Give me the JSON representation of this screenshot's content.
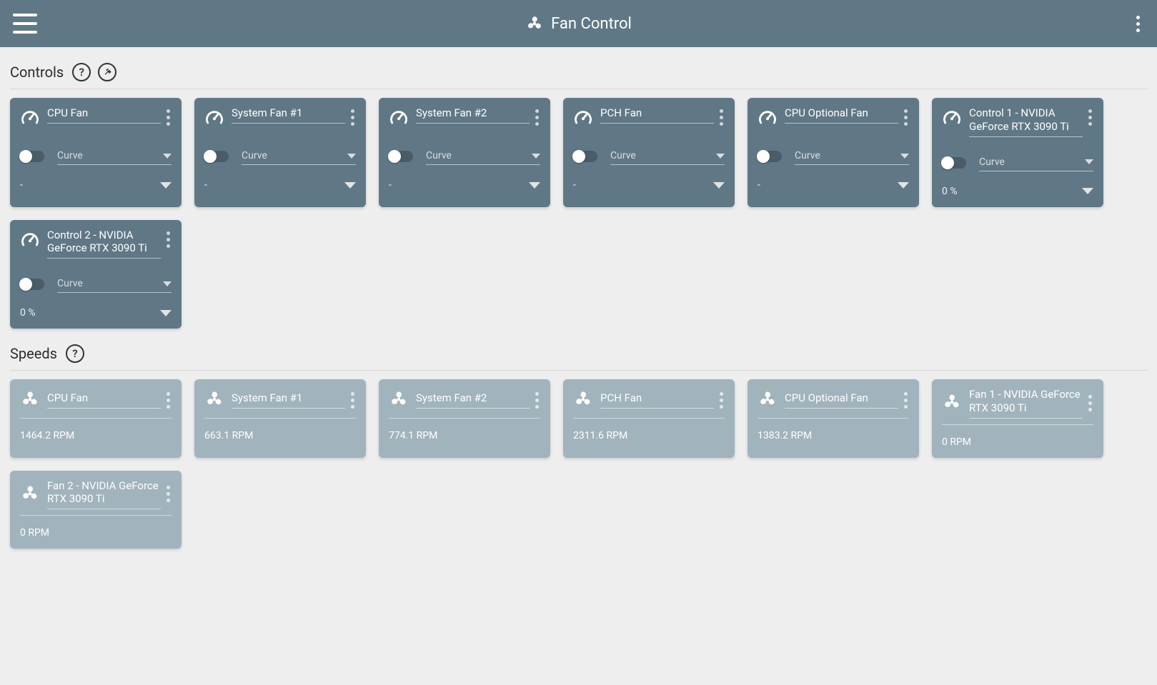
{
  "header": {
    "title": "Fan Control"
  },
  "sections": {
    "controls": {
      "title": "Controls",
      "dropdown_label": "Curve",
      "cards": [
        {
          "name": "CPU Fan",
          "status": "-"
        },
        {
          "name": "System Fan #1",
          "status": "-"
        },
        {
          "name": "System Fan #2",
          "status": "-"
        },
        {
          "name": "PCH Fan",
          "status": "-"
        },
        {
          "name": "CPU Optional Fan",
          "status": "-"
        },
        {
          "name": "Control 1 - NVIDIA GeForce RTX 3090 Ti",
          "status": "0 %"
        },
        {
          "name": "Control 2 - NVIDIA GeForce RTX 3090 Ti",
          "status": "0 %"
        }
      ]
    },
    "speeds": {
      "title": "Speeds",
      "cards": [
        {
          "name": "CPU Fan",
          "rpm": "1464.2 RPM"
        },
        {
          "name": "System Fan #1",
          "rpm": "663.1 RPM"
        },
        {
          "name": "System Fan #2",
          "rpm": "774.1 RPM"
        },
        {
          "name": "PCH Fan",
          "rpm": "2311.6 RPM"
        },
        {
          "name": "CPU Optional Fan",
          "rpm": "1383.2 RPM"
        },
        {
          "name": "Fan 1 - NVIDIA GeForce RTX 3090 Ti",
          "rpm": "0 RPM"
        },
        {
          "name": "Fan 2 - NVIDIA GeForce RTX 3090 Ti",
          "rpm": "0 RPM"
        }
      ]
    }
  }
}
